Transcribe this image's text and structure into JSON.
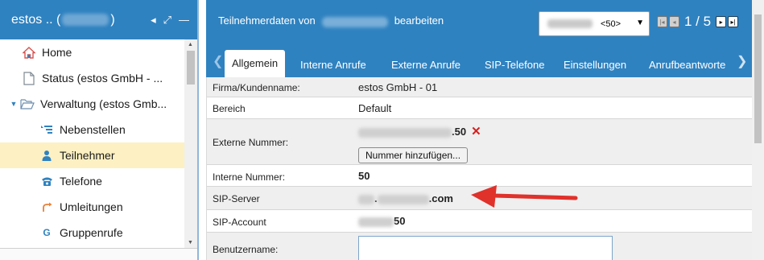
{
  "left_panel": {
    "title": "estos .. (",
    "title_close": ")",
    "controls": {
      "back": "◂",
      "expand": "⤢",
      "minimize": "—"
    },
    "tree": [
      {
        "label": "Home",
        "icon": "house-icon",
        "level": 0,
        "expandable": false
      },
      {
        "label": "Status (estos GmbH - ...",
        "icon": "document-icon",
        "level": 0,
        "expandable": false
      },
      {
        "label": "Verwaltung (estos Gmb...",
        "icon": "folder-open-icon",
        "level": 0,
        "expandable": true,
        "expanded": true
      },
      {
        "label": "Nebenstellen",
        "icon": "extensions-icon",
        "level": 1
      },
      {
        "label": "Teilnehmer",
        "icon": "user-icon",
        "level": 1,
        "selected": true
      },
      {
        "label": "Telefone",
        "icon": "telephone-icon",
        "level": 1
      },
      {
        "label": "Umleitungen",
        "icon": "redirect-icon",
        "level": 1
      },
      {
        "label": "Gruppenrufe",
        "icon": "group-call-icon",
        "level": 1
      }
    ]
  },
  "editor": {
    "title_prefix": "Teilnehmerdaten von",
    "title_suffix": "bearbeiten",
    "record_select": {
      "value": "<50>"
    },
    "pager": {
      "info": "1 / 5"
    },
    "tabs": [
      "Allgemein",
      "Interne Anrufe",
      "Externe Anrufe",
      "SIP-Telefone",
      "Einstellungen",
      "Anrufbeantworte"
    ],
    "active_tab": "Allgemein",
    "fields": {
      "firma": {
        "label": "Firma/Kundenname:",
        "value": "estos GmbH - 01"
      },
      "bereich": {
        "label": "Bereich",
        "value": "Default"
      },
      "externe": {
        "label": "Externe Nummer:",
        "value_suffix": ".50",
        "add_button": "Nummer hinzufügen..."
      },
      "interne": {
        "label": "Interne Nummer:",
        "value": "50"
      },
      "sip_server": {
        "label": "SIP-Server",
        "value_dot": ".",
        "value_suffix": ".com"
      },
      "sip_account": {
        "label": "SIP-Account",
        "value_suffix": "50"
      },
      "benutzer": {
        "label": "Benutzername:",
        "value": ""
      }
    }
  },
  "colors": {
    "header_blue": "#2f82c0",
    "selection": "#fdf0c2",
    "arrow_red": "#e0312b",
    "delete_red": "#d42020"
  }
}
